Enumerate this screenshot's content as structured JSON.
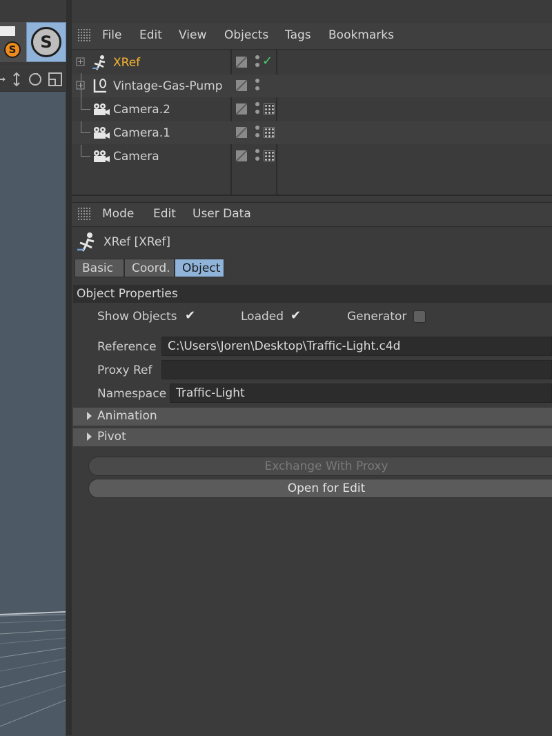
{
  "left_toolbar": {
    "badge_letter": "S",
    "big_letter": "S"
  },
  "object_manager": {
    "menu": [
      "File",
      "Edit",
      "View",
      "Objects",
      "Tags",
      "Bookmarks"
    ],
    "objects": [
      {
        "name": "XRef",
        "icon": "xref-icon",
        "selected": true
      },
      {
        "name": "Vintage-Gas-Pump",
        "icon": "null-object-icon",
        "selected": false
      },
      {
        "name": "Camera.2",
        "icon": "camera-icon",
        "selected": false
      },
      {
        "name": "Camera.1",
        "icon": "camera-icon",
        "selected": false
      },
      {
        "name": "Camera",
        "icon": "camera-icon",
        "selected": false
      }
    ]
  },
  "attribute_manager": {
    "menu": [
      "Mode",
      "Edit",
      "User Data"
    ],
    "title": "XRef [XRef]",
    "tabs": [
      {
        "label": "Basic",
        "active": false
      },
      {
        "label": "Coord.",
        "active": false
      },
      {
        "label": "Object",
        "active": true
      }
    ],
    "section_title": "Object Properties",
    "show_objects_label": "Show Objects",
    "loaded_label": "Loaded",
    "generator_label": "Generator",
    "check_glyph": "✔",
    "reference_label": "Reference",
    "reference_value": "C:\\Users\\Joren\\Desktop\\Traffic-Light.c4d",
    "proxy_ref_label": "Proxy Ref",
    "proxy_ref_value": "",
    "namespace_label": "Namespace",
    "namespace_value": "Traffic-Light",
    "animation_label": "Animation",
    "pivot_label": "Pivot",
    "exchange_button": "Exchange With Proxy",
    "open_button": "Open for Edit"
  },
  "colors": {
    "selected_text": "#f5b330",
    "active_tab": "#8fb3d9",
    "check_green": "#49d16a"
  }
}
